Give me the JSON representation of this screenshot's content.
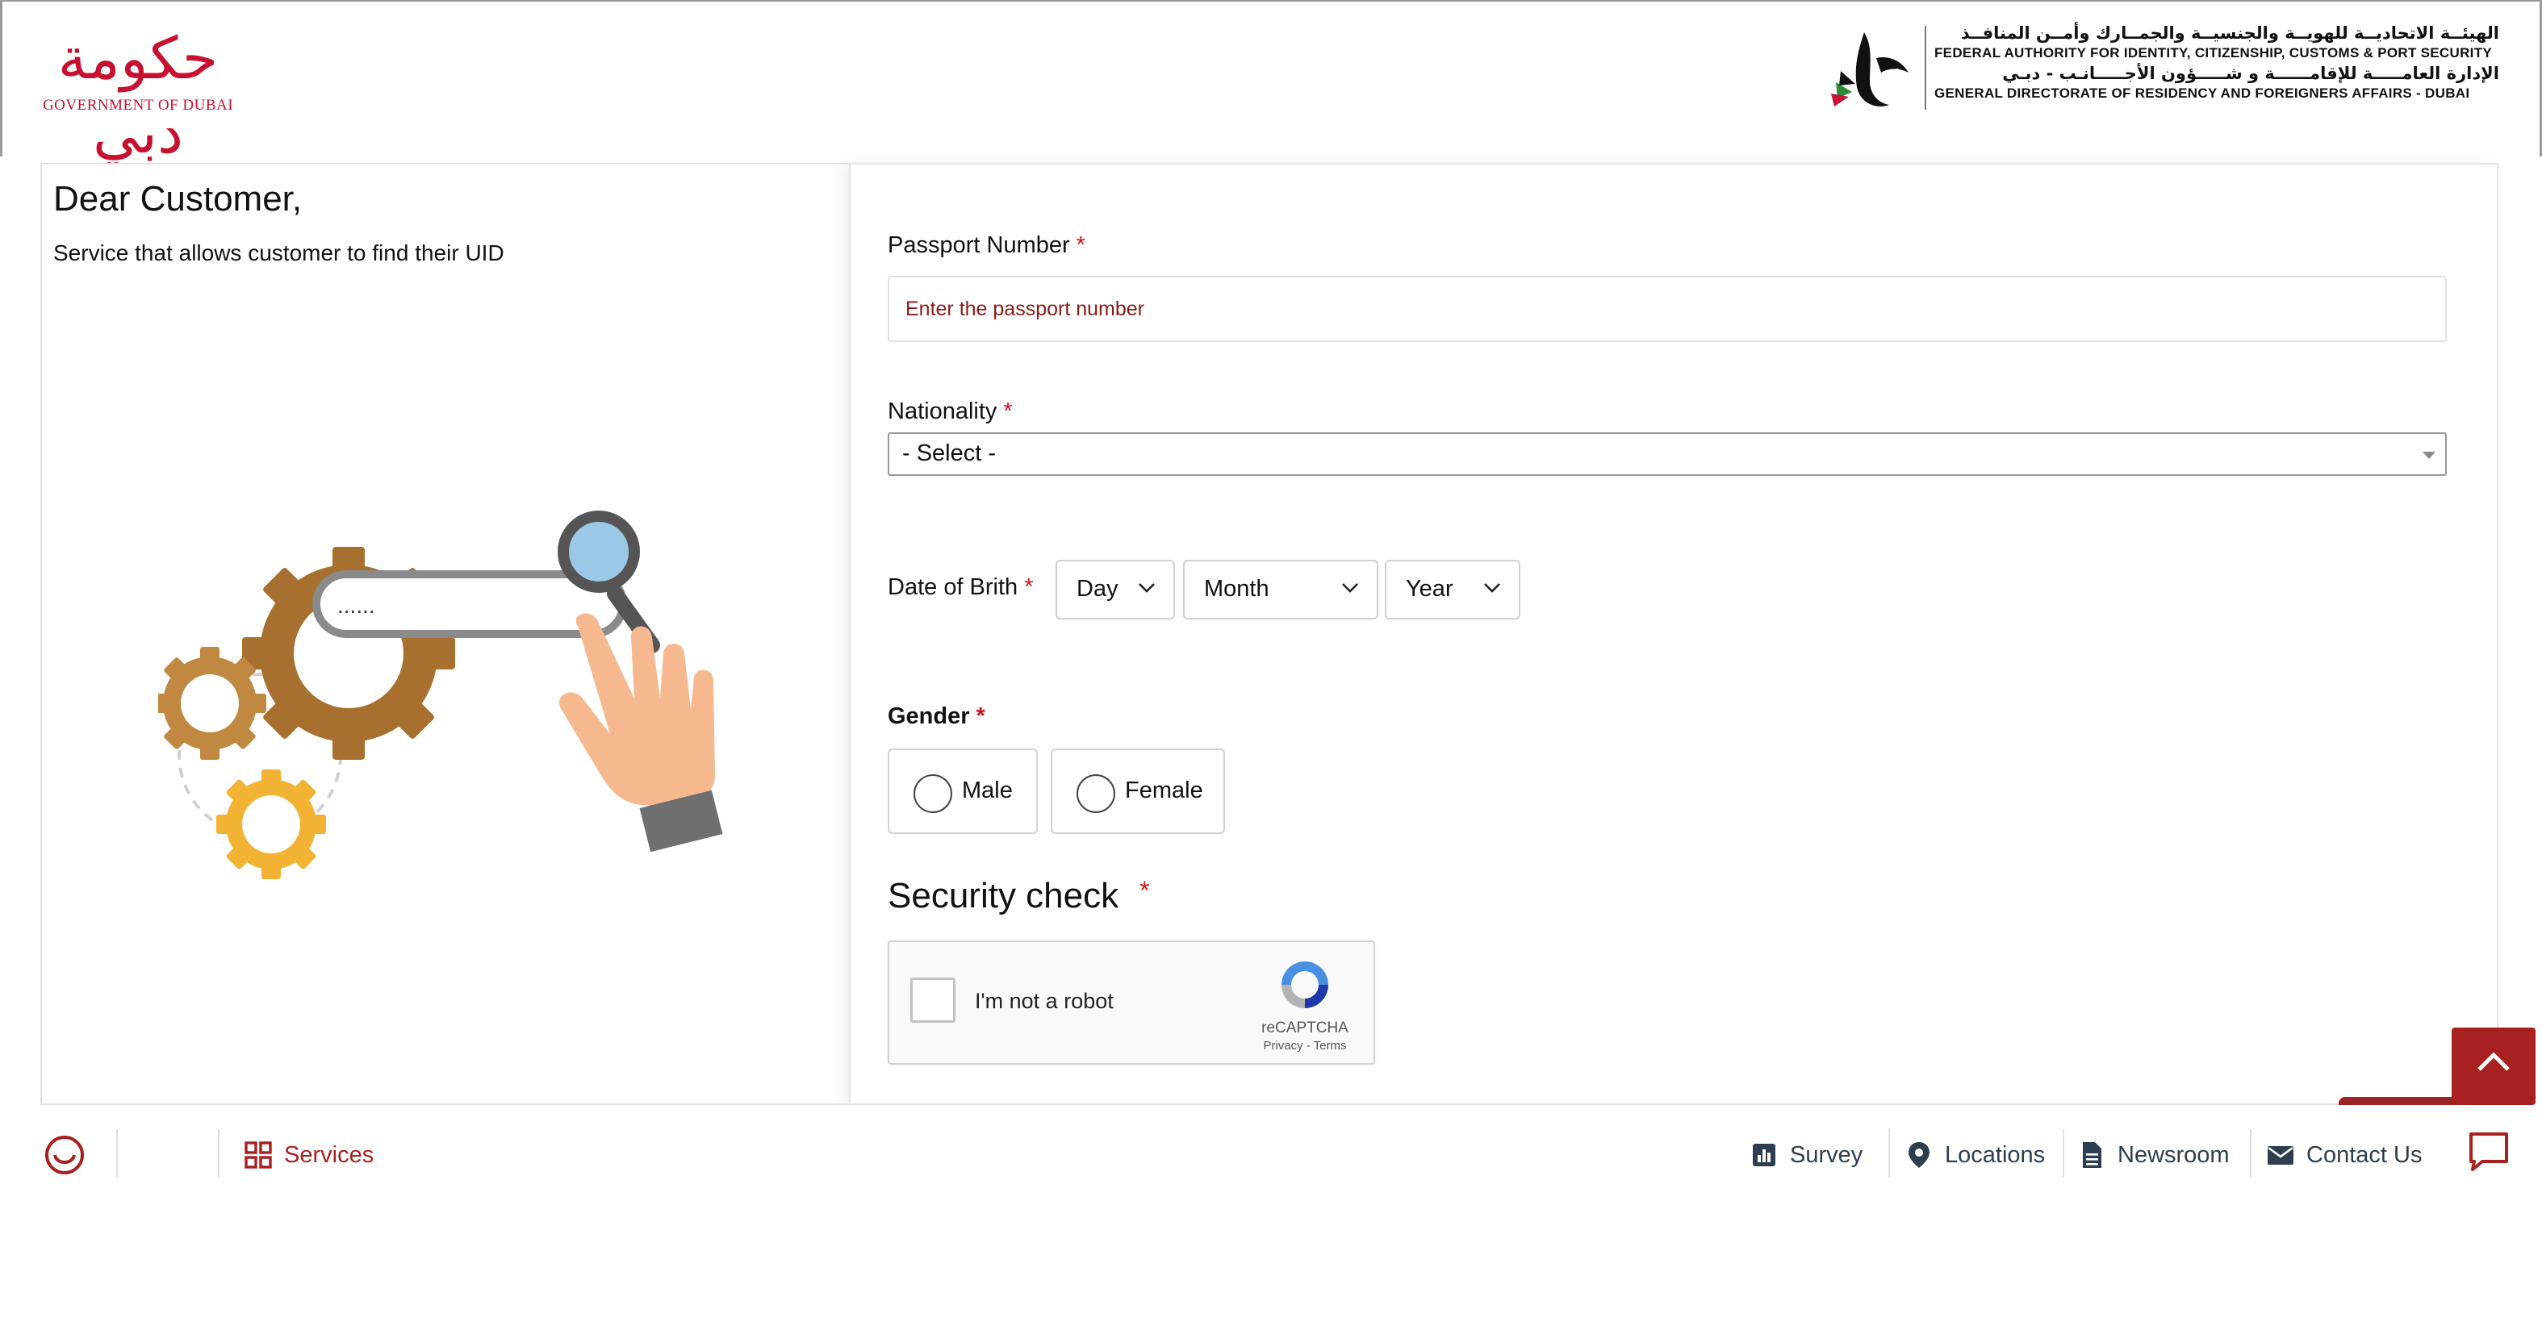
{
  "header": {
    "gov_logo_arabic": "حكومة دبي",
    "gov_logo_caption": "GOVERNMENT OF DUBAI",
    "ica_lines": [
      "الهيئــة الاتحاديــة للهويــة والجنسيــة والجمــارك وأمــن المنافــذ",
      "FEDERAL AUTHORITY FOR IDENTITY, CITIZENSHIP, CUSTOMS & PORT SECURITY",
      "الإدارة العامـــــة للإقامــــــة و شـــــؤون الأجـــــانـب - دبـي",
      "GENERAL DIRECTORATE OF RESIDENCY AND FOREIGNERS AFFAIRS - DUBAI"
    ]
  },
  "intro": {
    "greeting": "Dear Customer,",
    "description": "Service that allows customer to find their UID"
  },
  "illustration": {
    "search_text": "......"
  },
  "form": {
    "required_mark": "*",
    "passport": {
      "label": "Passport Number",
      "placeholder": "Enter the passport number",
      "value": ""
    },
    "nationality": {
      "label": "Nationality",
      "selected": "- Select -"
    },
    "dob": {
      "label": "Date of Brith",
      "day": "Day",
      "month": "Month",
      "year": "Year"
    },
    "gender": {
      "label": "Gender",
      "options": [
        "Male",
        "Female"
      ]
    },
    "security": {
      "title": "Security check",
      "captcha_label": "I'm not a robot",
      "captcha_brand": "reCAPTCHA",
      "captcha_links": "Privacy - Terms"
    }
  },
  "footer": {
    "services": "Services",
    "survey": "Survey",
    "locations": "Locations",
    "newsroom": "Newsroom",
    "contact": "Contact Us"
  },
  "colors": {
    "brand_red": "#a8201f",
    "required_red": "#d0121b",
    "footer_dark": "#2c3e50"
  },
  "icons": [
    "feedback-smiley-icon",
    "services-grid-icon",
    "survey-chart-icon",
    "location-pin-icon",
    "newsroom-document-icon",
    "contact-envelope-icon",
    "chat-bubble-icon",
    "chevron-up-icon",
    "recaptcha-logo-icon"
  ]
}
